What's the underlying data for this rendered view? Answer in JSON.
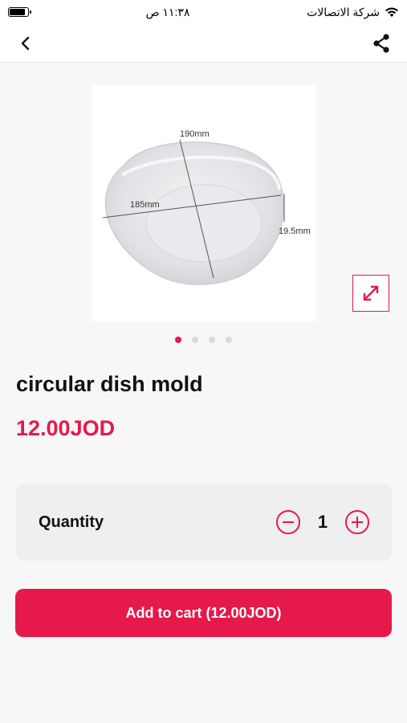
{
  "status_bar": {
    "carrier": "شركة الاتصالات",
    "time": "١١:٣٨ ص",
    "battery_level": 0.95
  },
  "nav": {
    "back_icon": "chevron-left-icon",
    "share_icon": "share-icon"
  },
  "product": {
    "title": "circular dish mold",
    "price": "12.00JOD",
    "image": {
      "dimension_top": "190mm",
      "dimension_left": "185mm",
      "dimension_right": "19.5mm"
    },
    "image_count": 4,
    "active_image_index": 0
  },
  "quantity": {
    "label": "Quantity",
    "value": "1",
    "decrement_icon": "minus-circle-icon",
    "increment_icon": "plus-circle-icon"
  },
  "cart": {
    "button_label": "Add to cart (12.00JOD)"
  },
  "colors": {
    "accent": "#e5194a",
    "background": "#f7f7f7"
  }
}
